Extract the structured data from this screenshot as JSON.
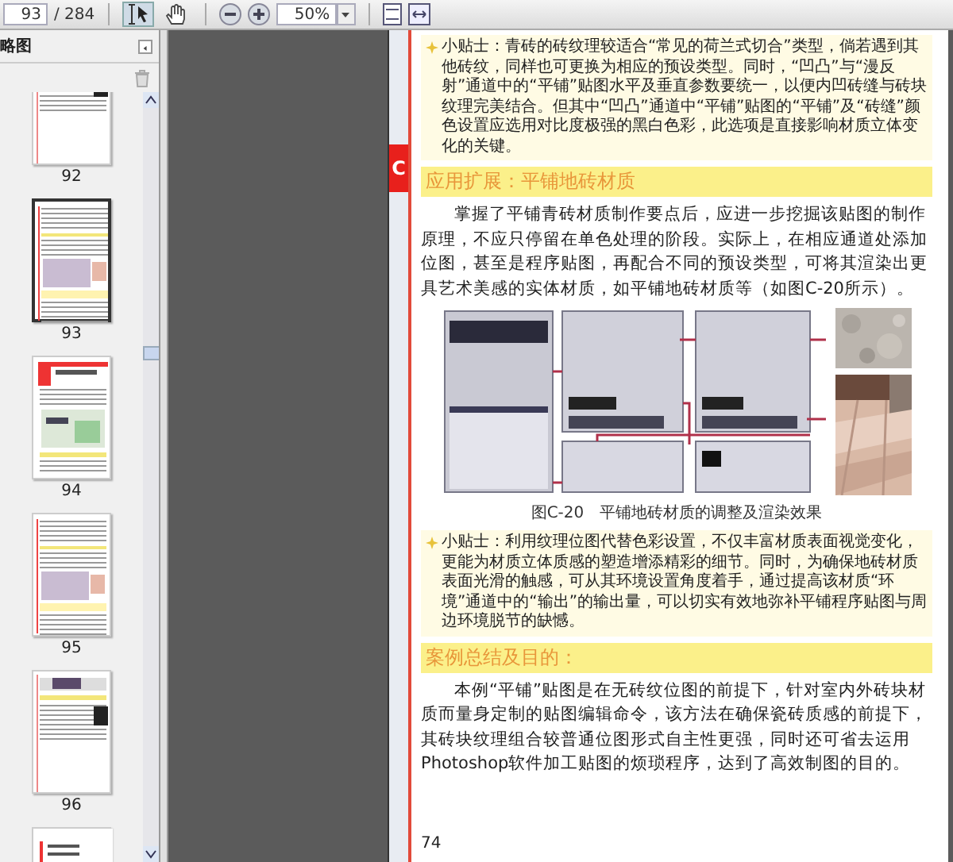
{
  "toolbar": {
    "page_field": {
      "value": "93"
    },
    "page_count": "/ 284",
    "tools": [
      {
        "kind": "select",
        "selected": true
      },
      {
        "kind": "hand",
        "selected": false
      }
    ],
    "zoom_field": {
      "value": "50%"
    }
  },
  "sidebar": {
    "title": "略图",
    "thumbnails": [
      {
        "kind": "text",
        "label": "92",
        "selected": false
      },
      {
        "kind": "figure",
        "label": "93",
        "selected": true
      },
      {
        "kind": "chapter",
        "label": "94",
        "selected": false
      },
      {
        "kind": "figure",
        "label": "95",
        "selected": false
      },
      {
        "kind": "text",
        "label": "96",
        "selected": false
      },
      {
        "kind": "cover",
        "selected": false
      }
    ]
  },
  "page": {
    "section_tab": "C",
    "page_number": "74",
    "blocks": [
      {
        "kind": "tip",
        "text": "小贴士：青砖的砖纹理较适合“常见的荷兰式切合”类型，倘若遇到其他砖纹，同样也可更换为相应的预设类型。同时，“凹凸”与“漫反射”通道中的“平铺”贴图水平及垂直参数要统一，以便内凹砖缝与砖块纹理完美结合。但其中“凹凸”通道中“平铺”贴图的“平铺”及“砖缝”颜色设置应选用对比度极强的黑白色彩，此选项是直接影响材质立体变化的关键。"
      },
      {
        "kind": "heading",
        "text": "应用扩展：平铺地砖材质"
      },
      {
        "kind": "paragraph",
        "text": "掌握了平铺青砖材质制作要点后，应进一步挖掘该贴图的制作原理，不应只停留在单色处理的阶段。实际上，在相应通道处添加位图，甚至是程序贴图，再配合不同的预设类型，可将其渲染出更具艺术美感的实体材质，如平铺地砖材质等（如图C-20所示）。"
      },
      {
        "kind": "figure",
        "caption": "图C-20　平铺地砖材质的调整及渲染效果"
      },
      {
        "kind": "tip",
        "text": "小贴士：利用纹理位图代替色彩设置，不仅丰富材质表面视觉变化，更能为材质立体质感的塑造增添精彩的细节。同时，为确保地砖材质表面光滑的触感，可从其环境设置角度着手，通过提高该材质“环境”通道中的“输出”的输出量，可以切实有效地弥补平铺程序贴图与周边环境脱节的缺憾。"
      },
      {
        "kind": "heading",
        "text": "案例总结及目的："
      },
      {
        "kind": "paragraph",
        "text": "本例“平铺”贴图是在无砖纹位图的前提下，针对室内外砖块材质而量身定制的贴图编辑命令，该方法在确保瓷砖质感的前提下，其砖块纹理组合较普通位图形式自主性更强，同时还可省去运用Photoshop软件加工贴图的烦琐程序，达到了高效制图的目的。"
      }
    ]
  }
}
